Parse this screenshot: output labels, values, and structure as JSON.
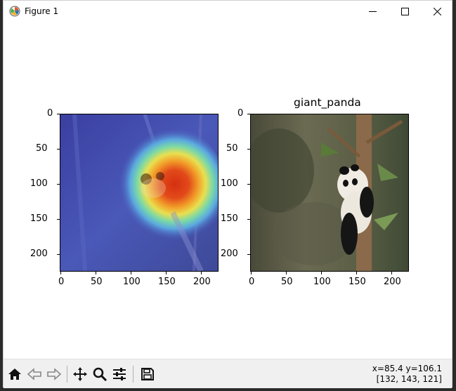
{
  "window": {
    "title": "Figure 1",
    "icons": {
      "app": "matplotlib-icon",
      "minimize": "minimize-icon",
      "maximize": "maximize-icon",
      "close": "close-icon"
    }
  },
  "figure": {
    "left_axes": {
      "title": "",
      "image": "grad-cam heatmap overlay on panda photo",
      "xticks": [
        "0",
        "50",
        "100",
        "150",
        "200"
      ],
      "yticks": [
        "0",
        "50",
        "100",
        "150",
        "200"
      ]
    },
    "right_axes": {
      "title": "giant_panda",
      "image": "giant panda climbing tree photo",
      "xticks": [
        "0",
        "50",
        "100",
        "150",
        "200"
      ],
      "yticks": [
        "0",
        "50",
        "100",
        "150",
        "200"
      ]
    }
  },
  "toolbar": {
    "buttons": [
      "home-icon",
      "back-icon",
      "forward-icon",
      "pan-icon",
      "zoom-icon",
      "configure-subplots-icon",
      "save-icon"
    ],
    "coords_line1": "x=85.4 y=106.1",
    "coords_line2": "[132, 143, 121]"
  }
}
